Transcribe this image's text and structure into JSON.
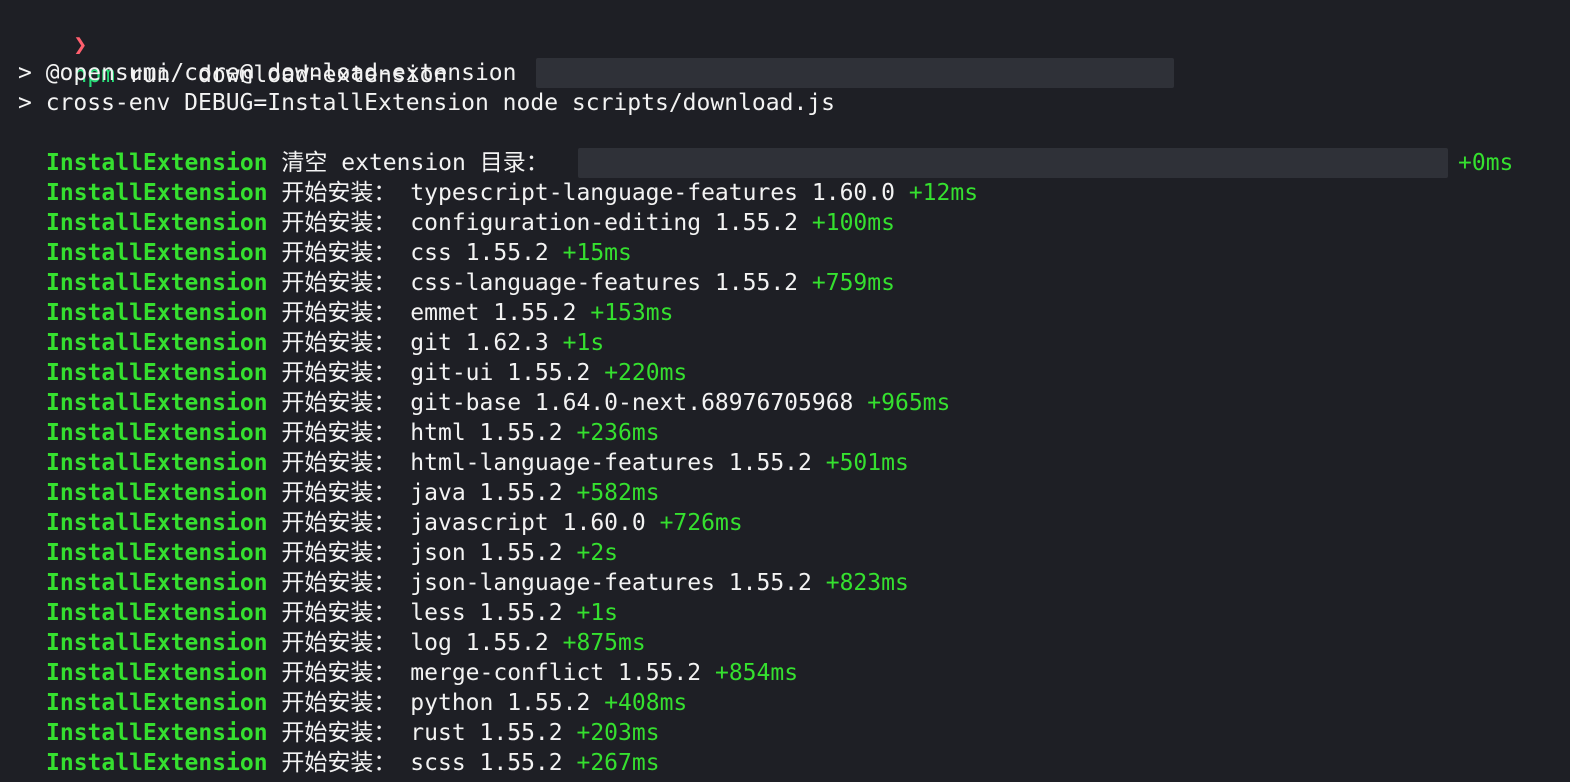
{
  "prompt": {
    "arrow": "❯",
    "npm": "npm",
    "rest": " run  download-extension"
  },
  "script_header": [
    "> @opensumi/core@ download-extension",
    "> cross-env DEBUG=InstallExtension node scripts/download.js"
  ],
  "clear_line": {
    "tag": "InstallExtension",
    "text": " 清空 extension 目录：",
    "time": "+0ms"
  },
  "install_prefix": "开始安装：",
  "install_lines": [
    {
      "tag": "InstallExtension",
      "name": "typescript-language-features",
      "version": "1.60.0",
      "time": "+12ms"
    },
    {
      "tag": "InstallExtension",
      "name": "configuration-editing",
      "version": "1.55.2",
      "time": "+100ms"
    },
    {
      "tag": "InstallExtension",
      "name": "css",
      "version": "1.55.2",
      "time": "+15ms"
    },
    {
      "tag": "InstallExtension",
      "name": "css-language-features",
      "version": "1.55.2",
      "time": "+759ms"
    },
    {
      "tag": "InstallExtension",
      "name": "emmet",
      "version": "1.55.2",
      "time": "+153ms"
    },
    {
      "tag": "InstallExtension",
      "name": "git",
      "version": "1.62.3",
      "time": "+1s"
    },
    {
      "tag": "InstallExtension",
      "name": "git-ui",
      "version": "1.55.2",
      "time": "+220ms"
    },
    {
      "tag": "InstallExtension",
      "name": "git-base",
      "version": "1.64.0-next.68976705968",
      "time": "+965ms"
    },
    {
      "tag": "InstallExtension",
      "name": "html",
      "version": "1.55.2",
      "time": "+236ms"
    },
    {
      "tag": "InstallExtension",
      "name": "html-language-features",
      "version": "1.55.2",
      "time": "+501ms"
    },
    {
      "tag": "InstallExtension",
      "name": "java",
      "version": "1.55.2",
      "time": "+582ms"
    },
    {
      "tag": "InstallExtension",
      "name": "javascript",
      "version": "1.60.0",
      "time": "+726ms"
    },
    {
      "tag": "InstallExtension",
      "name": "json",
      "version": "1.55.2",
      "time": "+2s"
    },
    {
      "tag": "InstallExtension",
      "name": "json-language-features",
      "version": "1.55.2",
      "time": "+823ms"
    },
    {
      "tag": "InstallExtension",
      "name": "less",
      "version": "1.55.2",
      "time": "+1s"
    },
    {
      "tag": "InstallExtension",
      "name": "log",
      "version": "1.55.2",
      "time": "+875ms"
    },
    {
      "tag": "InstallExtension",
      "name": "merge-conflict",
      "version": "1.55.2",
      "time": "+854ms"
    },
    {
      "tag": "InstallExtension",
      "name": "python",
      "version": "1.55.2",
      "time": "+408ms"
    },
    {
      "tag": "InstallExtension",
      "name": "rust",
      "version": "1.55.2",
      "time": "+203ms"
    },
    {
      "tag": "InstallExtension",
      "name": "scss",
      "version": "1.55.2",
      "time": "+267ms"
    }
  ],
  "colors": {
    "background": "#1e1f25",
    "text": "#f3f3f3",
    "debug_green": "#35e02f",
    "prompt_red": "#ff5f6e",
    "command_green": "#27e079",
    "redaction": "#2f3138"
  }
}
